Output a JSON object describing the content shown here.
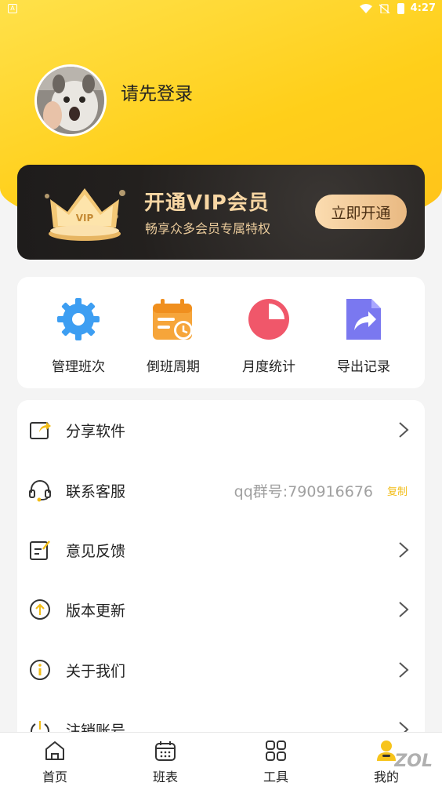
{
  "status_bar": {
    "time": "4:27"
  },
  "profile": {
    "login_prompt": "请先登录"
  },
  "vip": {
    "title": "开通VIP会员",
    "subtitle": "畅享众多会员专属特权",
    "button": "立即开通",
    "badge": "VIP"
  },
  "tools": [
    {
      "label": "管理班次",
      "icon": "gear-icon"
    },
    {
      "label": "倒班周期",
      "icon": "calendar-clock-icon"
    },
    {
      "label": "月度统计",
      "icon": "pie-chart-icon"
    },
    {
      "label": "导出记录",
      "icon": "export-file-icon"
    }
  ],
  "menu": {
    "share": "分享软件",
    "service": "联系客服",
    "qq_group": "qq群号:790916676",
    "copy": "复制",
    "feedback": "意见反馈",
    "update": "版本更新",
    "about": "关于我们",
    "logout": "注销账号"
  },
  "nav": [
    {
      "label": "首页",
      "icon": "home-icon"
    },
    {
      "label": "班表",
      "icon": "calendar-icon"
    },
    {
      "label": "工具",
      "icon": "grid-icon"
    },
    {
      "label": "我的",
      "icon": "user-icon"
    }
  ],
  "colors": {
    "accent": "#ffcf1a",
    "vip_gold": "#f7d6a3",
    "card_dark": "#23201e"
  },
  "watermark": "ZOL"
}
